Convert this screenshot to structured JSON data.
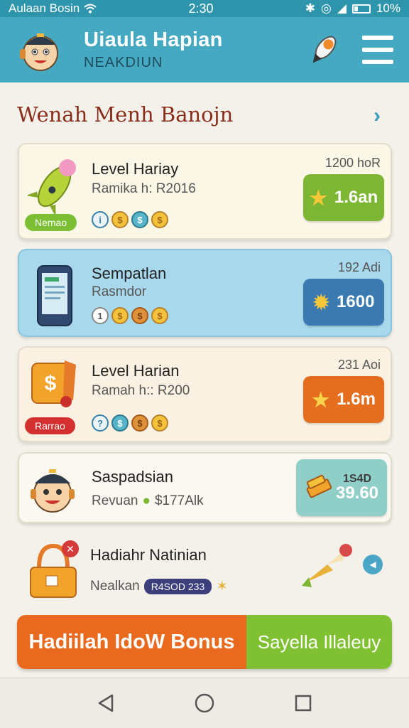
{
  "status": {
    "carrier": "Aulaan Bosin",
    "time": "2:30",
    "battery": "10%"
  },
  "header": {
    "title": "Uiaula Hapian",
    "subtitle": "NEAKDIUN"
  },
  "section": {
    "title": "Wenah Menh Banojn"
  },
  "cards": [
    {
      "title": "Level Hariay",
      "sub": "Ramika h: R2016",
      "meta": "1200 hoR",
      "tag": "Nemao",
      "button": "1.6an",
      "coins": [
        "i",
        "$",
        "$",
        "$"
      ]
    },
    {
      "title": "Sempatlan",
      "sub": "Rasmdor",
      "meta": "192 Adi",
      "button": "1600",
      "coins": [
        "1",
        "$",
        "$",
        "$"
      ]
    },
    {
      "title": "Level Harian",
      "sub": "Ramah h:: R200",
      "meta": "231 Aoi",
      "tag": "Rarrao",
      "button": "1.6m",
      "coins": [
        "?",
        "$",
        "$",
        "$"
      ]
    },
    {
      "title": "Saspadsian",
      "sub_prefix": "Revuan",
      "sub_value": "$177Alk",
      "price_top": "1S4D",
      "price_main": "39.60"
    },
    {
      "title": "Hadiahr Natinian",
      "sub_prefix": "Nealkan",
      "badge": "R4SOD 233"
    }
  ],
  "bigbar": {
    "left": "Hadiilah IdoW Bonus",
    "right": "Sayella Illaleuy"
  },
  "colors": {
    "header": "#45a9c1",
    "accent_orange": "#e9691f",
    "accent_green": "#80c033",
    "title_red": "#8a2e1c"
  }
}
